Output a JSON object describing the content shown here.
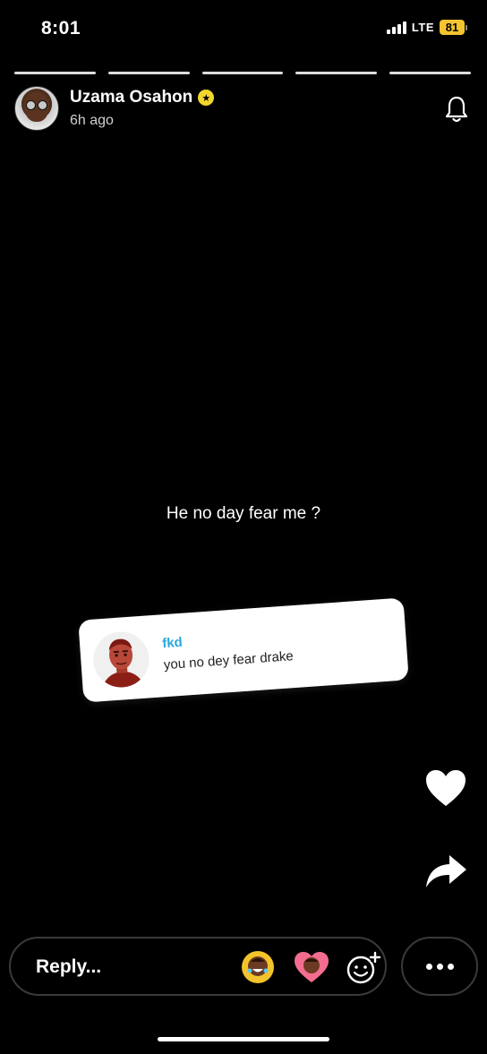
{
  "status_bar": {
    "time": "8:01",
    "network": "LTE",
    "battery": "81",
    "battery_color": "#f4c430"
  },
  "story": {
    "segments": 5,
    "user_name": "Uzama Osahon",
    "posted": "6h ago",
    "verified_badge_color": "#f3d72c",
    "caption": "He no day fear me ?",
    "reply_sticker": {
      "name": "fkd",
      "text": "you no dey fear drake",
      "name_color": "#2aa7dd"
    }
  },
  "icons": [
    "bell-icon",
    "heart-icon",
    "share-arrow-icon",
    "emoji-add-icon",
    "more-icon"
  ],
  "reply_bar": {
    "placeholder": "Reply..."
  }
}
